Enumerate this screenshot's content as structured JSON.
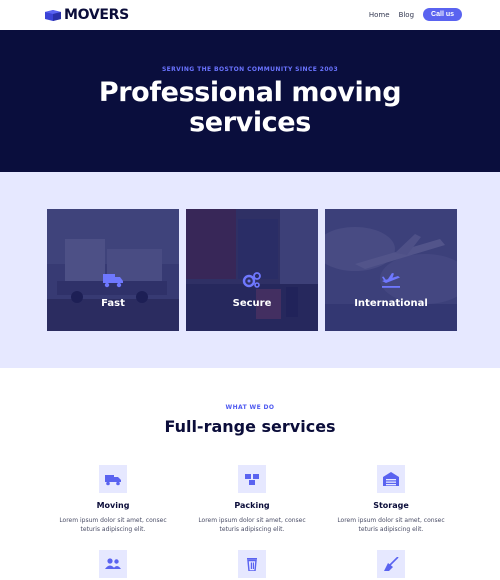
{
  "header": {
    "logo_text": "MOVERS",
    "nav": [
      {
        "label": "Home"
      },
      {
        "label": "Blog"
      }
    ],
    "cta_label": "Call us"
  },
  "hero": {
    "eyebrow": "SERVING THE BOSTON COMMUNITY SINCE 2003",
    "title_line1": "Professional moving",
    "title_line2": "services"
  },
  "features": [
    {
      "label": "Fast",
      "icon": "truck-icon"
    },
    {
      "label": "Secure",
      "icon": "gears-icon"
    },
    {
      "label": "International",
      "icon": "plane-icon"
    }
  ],
  "services": {
    "eyebrow": "WHAT WE DO",
    "title": "Full-range services",
    "items": [
      {
        "name": "Moving",
        "icon": "moving-truck-icon",
        "desc_line1": "Lorem ipsum dolor sit amet, consec",
        "desc_line2": "teturis adipiscing elit."
      },
      {
        "name": "Packing",
        "icon": "boxes-icon",
        "desc_line1": "Lorem ipsum dolor sit amet, consec",
        "desc_line2": "teturis adipiscing elit."
      },
      {
        "name": "Storage",
        "icon": "warehouse-icon",
        "desc_line1": "Lorem ipsum dolor sit amet, consec",
        "desc_line2": "teturis adipiscing elit."
      },
      {
        "name": "",
        "icon": "people-icon"
      },
      {
        "name": "",
        "icon": "trash-icon"
      },
      {
        "name": "",
        "icon": "broom-icon"
      }
    ]
  },
  "colors": {
    "brand_dark": "#0a0e3d",
    "accent": "#5a63f0",
    "band_bg": "#e6e8ff"
  }
}
